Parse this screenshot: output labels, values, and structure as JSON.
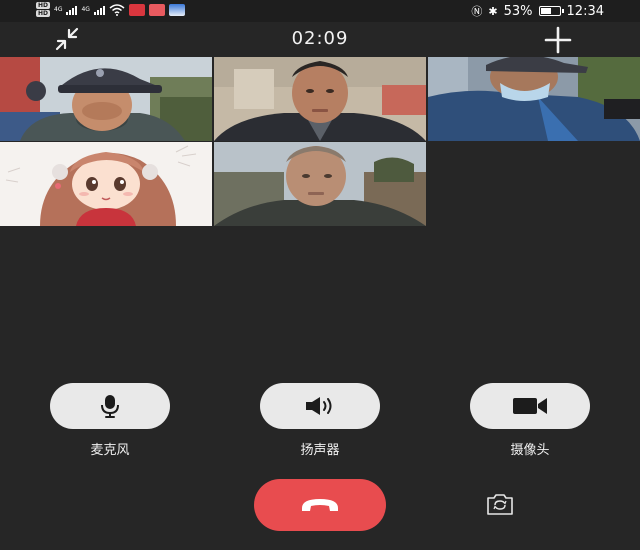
{
  "status_bar": {
    "sim1_tag": "HD",
    "sim2_tag": "HD",
    "net1": "4G",
    "net2": "4G",
    "battery_percent": "53%",
    "battery_level": 0.53,
    "time": "12:34"
  },
  "call": {
    "timer": "02:09",
    "minimize_icon": "minimize-arrows-icon",
    "add_icon": "plus-icon"
  },
  "participants": [
    {
      "id": "p1",
      "kind": "video"
    },
    {
      "id": "p2",
      "kind": "video"
    },
    {
      "id": "p3",
      "kind": "video"
    },
    {
      "id": "p4",
      "kind": "avatar-cartoon"
    },
    {
      "id": "p5",
      "kind": "video"
    }
  ],
  "controls": {
    "microphone_label": "麦克风",
    "speaker_label": "扬声器",
    "camera_label": "摄像头",
    "hangup_icon": "phone-hangup-icon",
    "switch_camera_icon": "switch-camera-icon"
  },
  "colors": {
    "background": "#262626",
    "control_button": "#e9e9e9",
    "hangup": "#e84c4f"
  }
}
